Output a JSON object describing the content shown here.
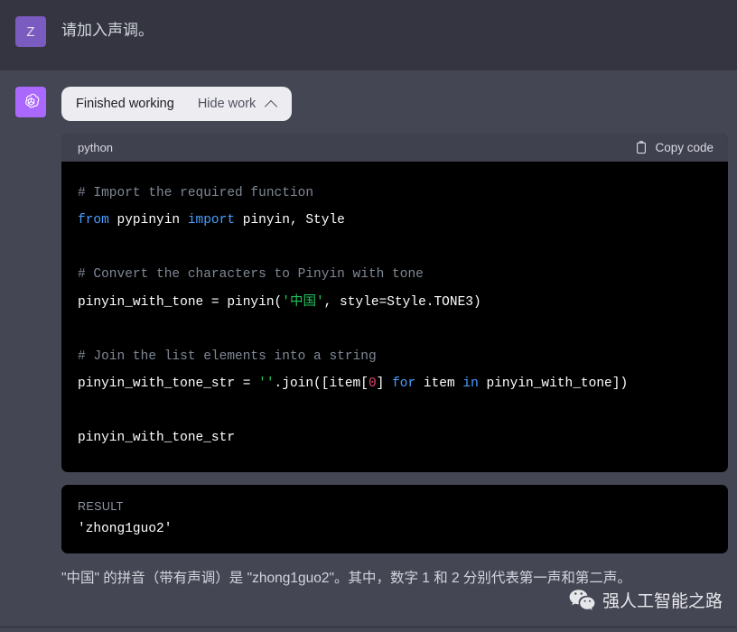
{
  "user_message": {
    "avatar_letter": "Z",
    "avatar_color": "#7a5bbf",
    "text": "请加入声调。"
  },
  "assistant_message": {
    "avatar_color": "#ab68ff",
    "avatar_icon": "openai-logo-icon",
    "work_pill": {
      "status_label": "Finished working",
      "toggle_label": "Hide work",
      "chevron_icon": "chevron-up-icon"
    },
    "code_block": {
      "language": "python",
      "copy_label": "Copy code",
      "copy_icon": "clipboard-icon",
      "lines": [
        [
          {
            "t": "# Import the required function",
            "c": "com"
          }
        ],
        [
          {
            "t": "from",
            "c": "kw"
          },
          {
            "t": " pypinyin ",
            "c": "pln"
          },
          {
            "t": "import",
            "c": "kw"
          },
          {
            "t": " pinyin, Style",
            "c": "pln"
          }
        ],
        [],
        [
          {
            "t": "# Convert the characters to Pinyin with tone",
            "c": "com"
          }
        ],
        [
          {
            "t": "pinyin_with_tone = pinyin(",
            "c": "pln"
          },
          {
            "t": "'中国'",
            "c": "str"
          },
          {
            "t": ", style=Style.TONE3)",
            "c": "pln"
          }
        ],
        [],
        [
          {
            "t": "# Join the list elements into a string",
            "c": "com"
          }
        ],
        [
          {
            "t": "pinyin_with_tone_str = ",
            "c": "pln"
          },
          {
            "t": "''",
            "c": "str"
          },
          {
            "t": ".join([item[",
            "c": "pln"
          },
          {
            "t": "0",
            "c": "num"
          },
          {
            "t": "] ",
            "c": "pln"
          },
          {
            "t": "for",
            "c": "kw"
          },
          {
            "t": " item ",
            "c": "pln"
          },
          {
            "t": "in",
            "c": "kw"
          },
          {
            "t": " pinyin_with_tone])",
            "c": "pln"
          }
        ],
        [],
        [
          {
            "t": "pinyin_with_tone_str",
            "c": "pln"
          }
        ]
      ]
    },
    "result_block": {
      "label": "RESULT",
      "value": "'zhong1guo2'"
    },
    "final_text": "\"中国\" 的拼音（带有声调）是 \"zhong1guo2\"。其中，数字 1 和 2 分别代表第一声和第二声。"
  },
  "watermark": {
    "icon": "wechat-icon",
    "text": "强人工智能之路"
  },
  "colors": {
    "user_bg": "#343541",
    "assistant_bg": "#444654",
    "code_bg": "#000000",
    "code_header_bg": "#40414f",
    "pill_bg": "#ececf1",
    "accent_purple": "#ab68ff",
    "keyword_blue": "#4a9eff",
    "string_green": "#22c55e",
    "number_pink": "#e0466d",
    "comment_gray": "#7f8895"
  }
}
